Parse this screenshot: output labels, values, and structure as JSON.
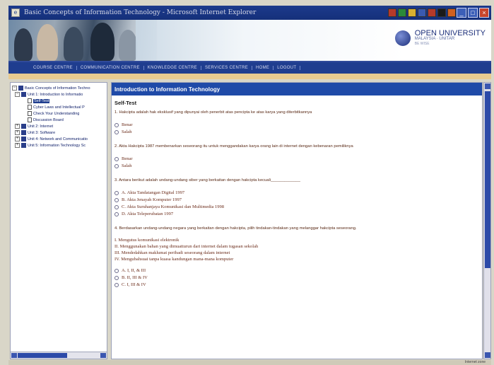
{
  "window": {
    "title": "Basic Concepts of Information Technology  -  Microsoft Internet Explorer",
    "tray_colors": [
      "#b53a2a",
      "#2a8a3a",
      "#d8b030",
      "#3a5ab0",
      "#b53a2a",
      "#1a1a1a",
      "#d06020"
    ],
    "controls": {
      "minimize": "_",
      "maximize": "□",
      "close": "×"
    }
  },
  "banner": {
    "logo_title": "OPEN UNIVERSITY",
    "logo_sub": "MALAYSIA · UNITAR",
    "logo_tag": "BE WISE"
  },
  "nav": {
    "items": [
      "COURSE CENTRE",
      "COMMUNICATION CENTRE",
      "KNOWLEDGE CENTRE",
      "SERVICES CENTRE",
      "HOME",
      "LOGOUT"
    ]
  },
  "tree": {
    "items": [
      {
        "label": "Basic Concepts of Information Techno",
        "type": "book",
        "expander": "−",
        "selected": false
      },
      {
        "label": "Unit 1: Introduction to Informatio",
        "type": "book",
        "expander": "−",
        "selected": false
      },
      {
        "label": "Self-Test",
        "type": "doc",
        "expander": "",
        "selected": true
      },
      {
        "label": "Cyber Laws and Intellectual P",
        "type": "doc",
        "expander": "",
        "selected": false
      },
      {
        "label": "Check Your Understanding",
        "type": "doc",
        "expander": "",
        "selected": false
      },
      {
        "label": "Discussion Board",
        "type": "doc",
        "expander": "",
        "selected": false
      },
      {
        "label": "Unit 2: Internet",
        "type": "book",
        "expander": "+",
        "selected": false
      },
      {
        "label": "Unit 3: Software",
        "type": "book",
        "expander": "+",
        "selected": false
      },
      {
        "label": "Unit 4: Network and Communicatio",
        "type": "book",
        "expander": "+",
        "selected": false
      },
      {
        "label": "Unit 5: Information Technology Sc",
        "type": "book",
        "expander": "+",
        "selected": false
      }
    ]
  },
  "content": {
    "header": "Introduction to Information Technology",
    "heading": "Self-Test",
    "q1": {
      "text": "1.  Hakcipta adalah hak eksklusif yang dipunyai oleh penerbit atas pencipta ke atas karya yang diterbitkannya",
      "options": [
        "Benar",
        "Salah"
      ]
    },
    "q2": {
      "text": "2.  Akta Hakcipta 1987 membenarkan seseorang itu untuk menggandakan karya orang lain di internet dengan kebenaran pemiliknya",
      "options": [
        "Benar",
        "Salah"
      ]
    },
    "q3": {
      "text": "3.  Antara berikut adalah undang-undang siber yang berkaitan dengan hakcipta kecuali_____________",
      "options": [
        "A.  Akta Tandatangan Digital 1997",
        "B.  Akta Jenayah Komputer 1997",
        "C.  Akta Suruhanjaya Komunikasi dan Multimedia 1998",
        "D.  Akta Teleperubatan 1997"
      ]
    },
    "q4": {
      "text": "4.  Berdasarkan undang-undang negara yang berkaitan dengan hakcipta, pilih tindakan-tindakan yang melanggar hakcipta seseorang.",
      "statements": [
        "I.  Mengutus komunikasi elektronik",
        "II.  Menggunakan bahan yang dimuatturun dari internet dalam tugasan sekolah",
        "III.  Mendedahkan maklumat peribadi seseorang dalam internet",
        "IV.  Mengubahsuai tanpa kuasa kandungan mana-mana komputer"
      ],
      "options": [
        "A. I, II, & III",
        "B. II, III & IV",
        "C. I, III & IV"
      ]
    }
  },
  "scrollbars": {
    "tree_h_left": "◂",
    "tree_h_right": "▸",
    "content_v_up": "▴",
    "content_v_down": "▾"
  },
  "statusbar": {
    "zone": "Internet zone"
  }
}
